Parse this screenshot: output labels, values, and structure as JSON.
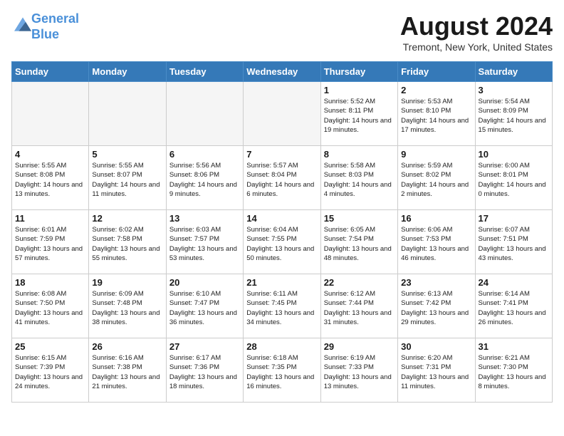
{
  "header": {
    "logo_line1": "General",
    "logo_line2": "Blue",
    "month_year": "August 2024",
    "location": "Tremont, New York, United States"
  },
  "weekdays": [
    "Sunday",
    "Monday",
    "Tuesday",
    "Wednesday",
    "Thursday",
    "Friday",
    "Saturday"
  ],
  "weeks": [
    [
      {
        "day": "",
        "info": ""
      },
      {
        "day": "",
        "info": ""
      },
      {
        "day": "",
        "info": ""
      },
      {
        "day": "",
        "info": ""
      },
      {
        "day": "1",
        "info": "Sunrise: 5:52 AM\nSunset: 8:11 PM\nDaylight: 14 hours\nand 19 minutes."
      },
      {
        "day": "2",
        "info": "Sunrise: 5:53 AM\nSunset: 8:10 PM\nDaylight: 14 hours\nand 17 minutes."
      },
      {
        "day": "3",
        "info": "Sunrise: 5:54 AM\nSunset: 8:09 PM\nDaylight: 14 hours\nand 15 minutes."
      }
    ],
    [
      {
        "day": "4",
        "info": "Sunrise: 5:55 AM\nSunset: 8:08 PM\nDaylight: 14 hours\nand 13 minutes."
      },
      {
        "day": "5",
        "info": "Sunrise: 5:55 AM\nSunset: 8:07 PM\nDaylight: 14 hours\nand 11 minutes."
      },
      {
        "day": "6",
        "info": "Sunrise: 5:56 AM\nSunset: 8:06 PM\nDaylight: 14 hours\nand 9 minutes."
      },
      {
        "day": "7",
        "info": "Sunrise: 5:57 AM\nSunset: 8:04 PM\nDaylight: 14 hours\nand 6 minutes."
      },
      {
        "day": "8",
        "info": "Sunrise: 5:58 AM\nSunset: 8:03 PM\nDaylight: 14 hours\nand 4 minutes."
      },
      {
        "day": "9",
        "info": "Sunrise: 5:59 AM\nSunset: 8:02 PM\nDaylight: 14 hours\nand 2 minutes."
      },
      {
        "day": "10",
        "info": "Sunrise: 6:00 AM\nSunset: 8:01 PM\nDaylight: 14 hours\nand 0 minutes."
      }
    ],
    [
      {
        "day": "11",
        "info": "Sunrise: 6:01 AM\nSunset: 7:59 PM\nDaylight: 13 hours\nand 57 minutes."
      },
      {
        "day": "12",
        "info": "Sunrise: 6:02 AM\nSunset: 7:58 PM\nDaylight: 13 hours\nand 55 minutes."
      },
      {
        "day": "13",
        "info": "Sunrise: 6:03 AM\nSunset: 7:57 PM\nDaylight: 13 hours\nand 53 minutes."
      },
      {
        "day": "14",
        "info": "Sunrise: 6:04 AM\nSunset: 7:55 PM\nDaylight: 13 hours\nand 50 minutes."
      },
      {
        "day": "15",
        "info": "Sunrise: 6:05 AM\nSunset: 7:54 PM\nDaylight: 13 hours\nand 48 minutes."
      },
      {
        "day": "16",
        "info": "Sunrise: 6:06 AM\nSunset: 7:53 PM\nDaylight: 13 hours\nand 46 minutes."
      },
      {
        "day": "17",
        "info": "Sunrise: 6:07 AM\nSunset: 7:51 PM\nDaylight: 13 hours\nand 43 minutes."
      }
    ],
    [
      {
        "day": "18",
        "info": "Sunrise: 6:08 AM\nSunset: 7:50 PM\nDaylight: 13 hours\nand 41 minutes."
      },
      {
        "day": "19",
        "info": "Sunrise: 6:09 AM\nSunset: 7:48 PM\nDaylight: 13 hours\nand 38 minutes."
      },
      {
        "day": "20",
        "info": "Sunrise: 6:10 AM\nSunset: 7:47 PM\nDaylight: 13 hours\nand 36 minutes."
      },
      {
        "day": "21",
        "info": "Sunrise: 6:11 AM\nSunset: 7:45 PM\nDaylight: 13 hours\nand 34 minutes."
      },
      {
        "day": "22",
        "info": "Sunrise: 6:12 AM\nSunset: 7:44 PM\nDaylight: 13 hours\nand 31 minutes."
      },
      {
        "day": "23",
        "info": "Sunrise: 6:13 AM\nSunset: 7:42 PM\nDaylight: 13 hours\nand 29 minutes."
      },
      {
        "day": "24",
        "info": "Sunrise: 6:14 AM\nSunset: 7:41 PM\nDaylight: 13 hours\nand 26 minutes."
      }
    ],
    [
      {
        "day": "25",
        "info": "Sunrise: 6:15 AM\nSunset: 7:39 PM\nDaylight: 13 hours\nand 24 minutes."
      },
      {
        "day": "26",
        "info": "Sunrise: 6:16 AM\nSunset: 7:38 PM\nDaylight: 13 hours\nand 21 minutes."
      },
      {
        "day": "27",
        "info": "Sunrise: 6:17 AM\nSunset: 7:36 PM\nDaylight: 13 hours\nand 18 minutes."
      },
      {
        "day": "28",
        "info": "Sunrise: 6:18 AM\nSunset: 7:35 PM\nDaylight: 13 hours\nand 16 minutes."
      },
      {
        "day": "29",
        "info": "Sunrise: 6:19 AM\nSunset: 7:33 PM\nDaylight: 13 hours\nand 13 minutes."
      },
      {
        "day": "30",
        "info": "Sunrise: 6:20 AM\nSunset: 7:31 PM\nDaylight: 13 hours\nand 11 minutes."
      },
      {
        "day": "31",
        "info": "Sunrise: 6:21 AM\nSunset: 7:30 PM\nDaylight: 13 hours\nand 8 minutes."
      }
    ]
  ]
}
